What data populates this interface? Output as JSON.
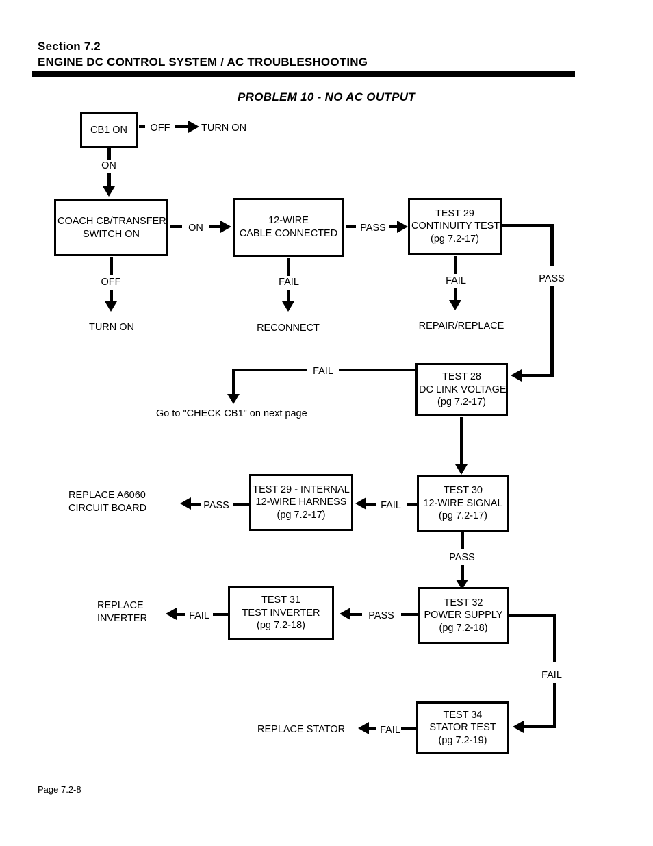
{
  "header": {
    "section": "Section 7.2",
    "title": "ENGINE DC CONTROL SYSTEM / AC TROUBLESHOOTING"
  },
  "chart_title": "PROBLEM 10 - NO AC OUTPUT",
  "footer": {
    "page": "Page 7.2-8"
  },
  "nodes": {
    "cb1_on": {
      "line1": "CB1 ON"
    },
    "coach_switch": {
      "line1": "COACH CB/TRANSFER",
      "line2": "SWITCH ON"
    },
    "cable_connected": {
      "line1": "12-WIRE",
      "line2": "CABLE CONNECTED"
    },
    "test29_continuity": {
      "line1": "TEST 29",
      "line2": "CONTINUITY TEST",
      "line3": "(pg 7.2-17)"
    },
    "test28_dclink": {
      "line1": "TEST 28",
      "line2": "DC LINK VOLTAGE",
      "line3": "(pg 7.2-17)"
    },
    "test29_internal": {
      "line1": "TEST 29 - INTERNAL",
      "line2": "12-WIRE HARNESS",
      "line3": "(pg 7.2-17)"
    },
    "test30_signal": {
      "line1": "TEST 30",
      "line2": "12-WIRE SIGNAL",
      "line3": "(pg 7.2-17)"
    },
    "test31_inverter": {
      "line1": "TEST 31",
      "line2": "TEST INVERTER",
      "line3": "(pg 7.2-18)"
    },
    "test32_power": {
      "line1": "TEST 32",
      "line2": "POWER SUPPLY",
      "line3": "(pg 7.2-18)"
    },
    "test34_stator": {
      "line1": "TEST 34",
      "line2": "STATOR TEST",
      "line3": "(pg 7.2-19)"
    }
  },
  "terminals": {
    "turn_on_top": "TURN ON",
    "turn_on_left": "TURN ON",
    "reconnect": "RECONNECT",
    "repair_replace": "REPAIR/REPLACE",
    "check_cb1": "Go to \"CHECK CB1\" on next page",
    "replace_a6060_line1": "REPLACE A6060",
    "replace_a6060_line2": "CIRCUIT BOARD",
    "replace_inverter_line1": "REPLACE",
    "replace_inverter_line2": "INVERTER",
    "replace_stator": "REPLACE STATOR"
  },
  "edges": {
    "cb1_off": "OFF",
    "cb1_on": "ON",
    "coach_on": "ON",
    "coach_off": "OFF",
    "cable_fail": "FAIL",
    "cable_pass": "PASS",
    "test29_fail": "FAIL",
    "test29_pass": "PASS",
    "test28_fail": "FAIL",
    "test30_fail": "FAIL",
    "test30_pass": "PASS",
    "test29int_pass": "PASS",
    "test31_fail": "FAIL",
    "test32_pass": "PASS",
    "test32_fail": "FAIL",
    "test34_fail": "FAIL"
  }
}
